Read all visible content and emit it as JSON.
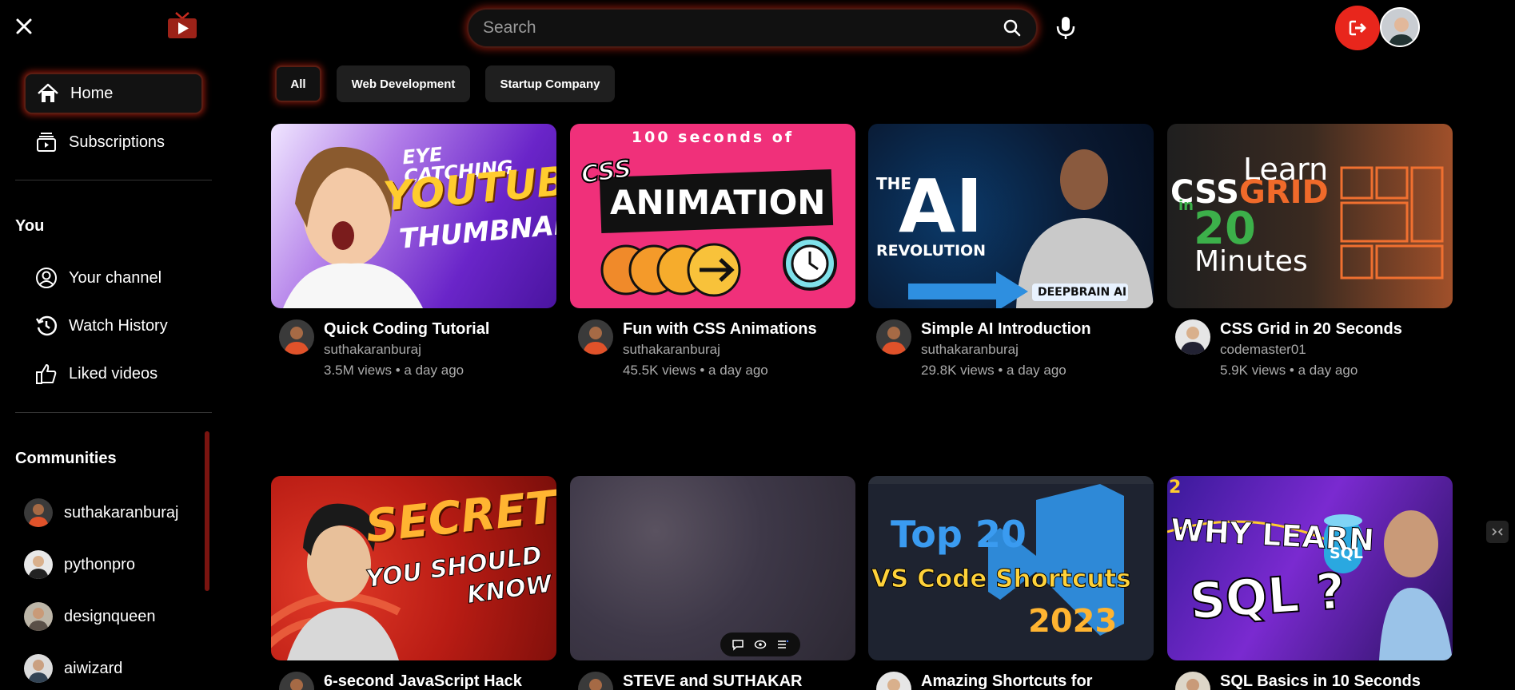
{
  "header": {
    "search_placeholder": "Search"
  },
  "sidebar": {
    "items": [
      {
        "label": "Home"
      },
      {
        "label": "Subscriptions"
      }
    ],
    "you_heading": "You",
    "you_items": [
      {
        "label": "Your channel"
      },
      {
        "label": "Watch History"
      },
      {
        "label": "Liked videos"
      }
    ],
    "communities_heading": "Communities",
    "communities": [
      {
        "label": "suthakaranburaj"
      },
      {
        "label": "pythonpro"
      },
      {
        "label": "designqueen"
      },
      {
        "label": "aiwizard"
      }
    ]
  },
  "chips": [
    {
      "label": "All",
      "active": true
    },
    {
      "label": "Web Development"
    },
    {
      "label": "Startup Company"
    }
  ],
  "videos": [
    {
      "title": "Quick Coding Tutorial",
      "channel": "suthakaranburaj",
      "stats": "3.5M views • a day ago",
      "thumb_text": [
        "EYE CATCHING",
        "YOUTUBE",
        "THUMBNAIL"
      ]
    },
    {
      "title": "Fun with CSS Animations",
      "channel": "suthakaranburaj",
      "stats": "45.5K views • a day ago",
      "thumb_text": [
        "100 seconds of",
        "CSS",
        "ANIMATION"
      ]
    },
    {
      "title": "Simple AI Introduction",
      "channel": "suthakaranburaj",
      "stats": "29.8K views • a day ago",
      "thumb_text": [
        "THE",
        "AI",
        "REVOLUTION",
        "DEEPBRAIN AI"
      ]
    },
    {
      "title": "CSS Grid in 20 Seconds",
      "channel": "codemaster01",
      "stats": "5.9K views • a day ago",
      "thumb_text": [
        "Learn",
        "CSS",
        "GRID",
        "in",
        "20",
        "Minutes"
      ]
    },
    {
      "title": "6-second JavaScript Hack",
      "thumb_text": [
        "SECRETS",
        "YOU SHOULD",
        "KNOW"
      ]
    },
    {
      "title": "STEVE and SUTHAKAR",
      "thumb_text": []
    },
    {
      "title": "Amazing Shortcuts for",
      "thumb_text": [
        "Top 20",
        "VS Code Shortcuts",
        "2023"
      ]
    },
    {
      "title": "SQL Basics in 10 Seconds",
      "thumb_text": [
        "2",
        "WHY LEARN",
        "SQL ?",
        "SQL"
      ]
    }
  ],
  "colors": {
    "accent": "#e8261c",
    "glow": "#dc2814",
    "background": "#000000",
    "muted_text": "#aaaaaa"
  }
}
